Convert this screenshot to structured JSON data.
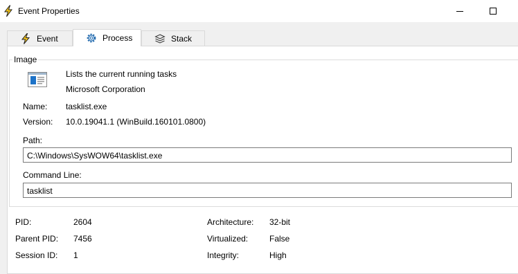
{
  "window": {
    "title": "Event Properties"
  },
  "tabs": [
    {
      "label": "Event"
    },
    {
      "label": "Process"
    },
    {
      "label": "Stack"
    }
  ],
  "image_group": {
    "label": "Image",
    "description": "Lists the current running tasks",
    "company": "Microsoft Corporation",
    "name_label": "Name:",
    "name_value": "tasklist.exe",
    "version_label": "Version:",
    "version_value": "10.0.19041.1 (WinBuild.160101.0800)",
    "path_label": "Path:",
    "path_value": "C:\\Windows\\SysWOW64\\tasklist.exe",
    "cmd_label": "Command Line:",
    "cmd_value": "tasklist"
  },
  "details": {
    "pid_label": "PID:",
    "pid_value": "2604",
    "parent_pid_label": "Parent PID:",
    "parent_pid_value": "7456",
    "session_id_label": "Session ID:",
    "session_id_value": "1",
    "architecture_label": "Architecture:",
    "architecture_value": "32-bit",
    "virtualized_label": "Virtualized:",
    "virtualized_value": "False",
    "integrity_label": "Integrity:",
    "integrity_value": "High"
  }
}
